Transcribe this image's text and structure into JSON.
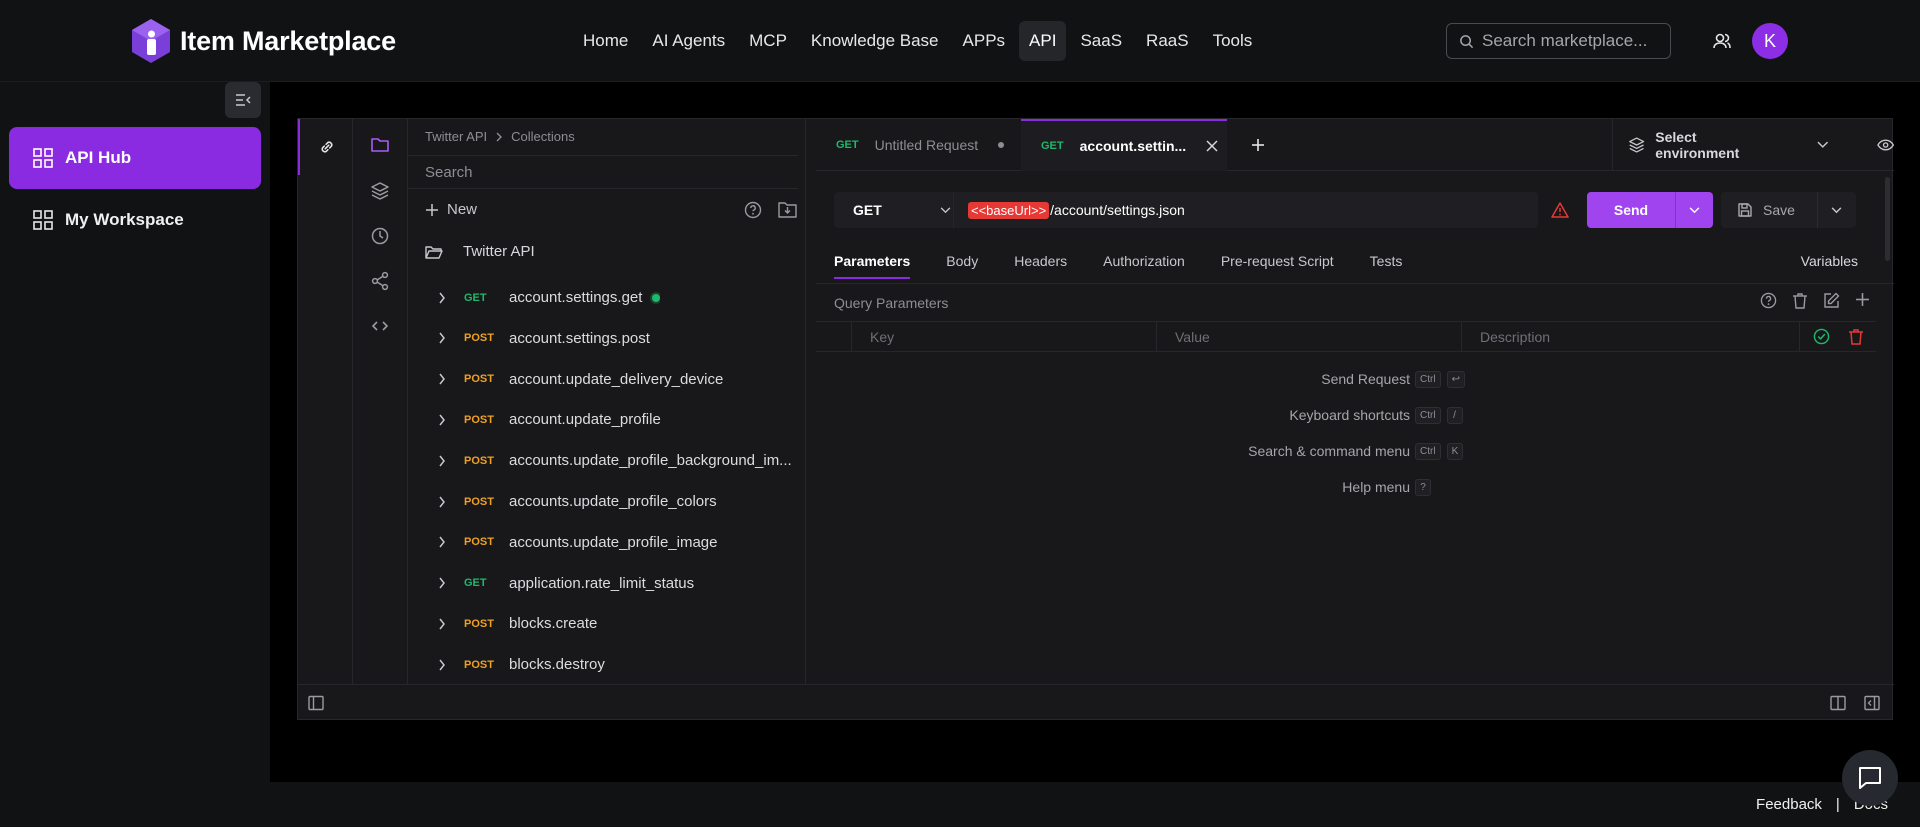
{
  "brand": {
    "name": "Item Marketplace"
  },
  "nav": {
    "items": [
      {
        "label": "Home",
        "active": false
      },
      {
        "label": "AI Agents",
        "active": false
      },
      {
        "label": "MCP",
        "active": false
      },
      {
        "label": "Knowledge Base",
        "active": false
      },
      {
        "label": "APPs",
        "active": false
      },
      {
        "label": "API",
        "active": true
      },
      {
        "label": "SaaS",
        "active": false
      },
      {
        "label": "RaaS",
        "active": false
      },
      {
        "label": "Tools",
        "active": false
      }
    ]
  },
  "search": {
    "placeholder": "Search marketplace..."
  },
  "user": {
    "avatar_initial": "K"
  },
  "sidebar": {
    "items": [
      {
        "label": "API Hub",
        "active": true
      },
      {
        "label": "My Workspace",
        "active": false
      }
    ]
  },
  "client": {
    "breadcrumb": [
      "Twitter API",
      "Collections"
    ],
    "tree_search_placeholder": "Search",
    "new_label": "New",
    "collection_name": "Twitter API",
    "requests": [
      {
        "method": "GET",
        "name": "account.settings.get",
        "active_dot": true
      },
      {
        "method": "POST",
        "name": "account.settings.post"
      },
      {
        "method": "POST",
        "name": "account.update_delivery_device"
      },
      {
        "method": "POST",
        "name": "account.update_profile"
      },
      {
        "method": "POST",
        "name": "accounts.update_profile_background_im..."
      },
      {
        "method": "POST",
        "name": "accounts.update_profile_colors"
      },
      {
        "method": "POST",
        "name": "accounts.update_profile_image"
      },
      {
        "method": "GET",
        "name": "application.rate_limit_status"
      },
      {
        "method": "POST",
        "name": "blocks.create"
      },
      {
        "method": "POST",
        "name": "blocks.destroy"
      }
    ],
    "tabs": [
      {
        "method": "GET",
        "label": "Untitled Request",
        "active": false
      },
      {
        "method": "GET",
        "label": "account.settin...",
        "active": true
      }
    ],
    "environment_label": "Select environment",
    "request": {
      "method": "GET",
      "base_var": "<<baseUrl>>",
      "path": "/account/settings.json",
      "send_label": "Send",
      "save_label": "Save"
    },
    "sub_tabs": [
      "Parameters",
      "Body",
      "Headers",
      "Authorization",
      "Pre-request Script",
      "Tests"
    ],
    "variables_label": "Variables",
    "query_params_title": "Query Parameters",
    "columns": [
      "Key",
      "Value",
      "Description"
    ],
    "shortcuts": [
      {
        "label": "Send Request",
        "keys": [
          "Ctrl",
          "↩"
        ]
      },
      {
        "label": "Keyboard shortcuts",
        "keys": [
          "Ctrl",
          "/"
        ]
      },
      {
        "label": "Search & command menu",
        "keys": [
          "Ctrl",
          "K"
        ]
      },
      {
        "label": "Help menu",
        "keys": [
          "?"
        ]
      }
    ]
  },
  "footer": {
    "feedback": "Feedback",
    "separator": "|",
    "docs": "Docs"
  },
  "colors": {
    "accent": "#8a2be2",
    "send": "#a044f0",
    "get": "#1fb86a",
    "post": "#f0a020",
    "error": "#e53935"
  }
}
